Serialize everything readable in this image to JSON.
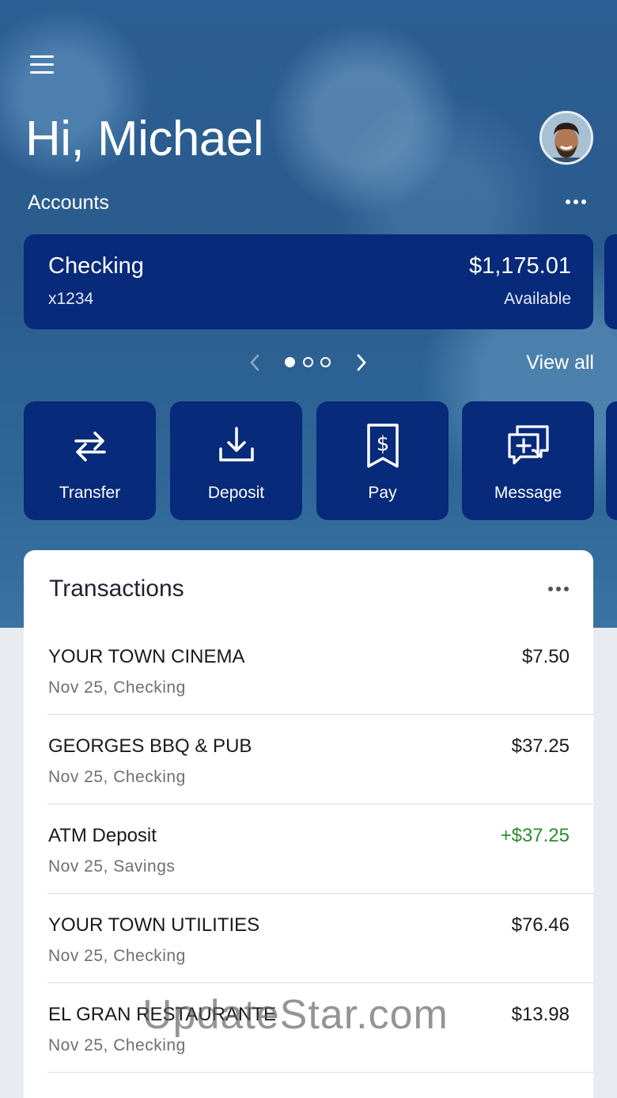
{
  "header": {
    "greeting": "Hi, Michael",
    "accounts_label": "Accounts"
  },
  "account": {
    "name": "Checking",
    "number": "x1234",
    "balance": "$1,175.01",
    "balance_label": "Available"
  },
  "pager": {
    "view_all": "View all",
    "current_page": 1,
    "total_pages": 3
  },
  "actions": [
    {
      "label": "Transfer",
      "icon": "transfer-icon"
    },
    {
      "label": "Deposit",
      "icon": "deposit-icon"
    },
    {
      "label": "Pay",
      "icon": "pay-icon"
    },
    {
      "label": "Message",
      "icon": "message-icon"
    }
  ],
  "transactions": {
    "title": "Transactions",
    "items": [
      {
        "name": "YOUR TOWN CINEMA",
        "sub": "Nov 25, Checking",
        "amount": "$7.50"
      },
      {
        "name": "GEORGES BBQ & PUB",
        "sub": "Nov 25, Checking",
        "amount": "$37.25"
      },
      {
        "name": "ATM Deposit",
        "sub": "Nov 25, Savings",
        "amount": "+$37.25"
      },
      {
        "name": "YOUR TOWN UTILITIES",
        "sub": "Nov 25, Checking",
        "amount": "$76.46"
      },
      {
        "name": "EL GRAN RESTAURANTE",
        "sub": "Nov 25, Checking",
        "amount": "$13.98"
      }
    ]
  },
  "watermark": "UpdateStar.com",
  "colors": {
    "brand_navy": "#072a7a",
    "credit_green": "#2e8b2e"
  }
}
